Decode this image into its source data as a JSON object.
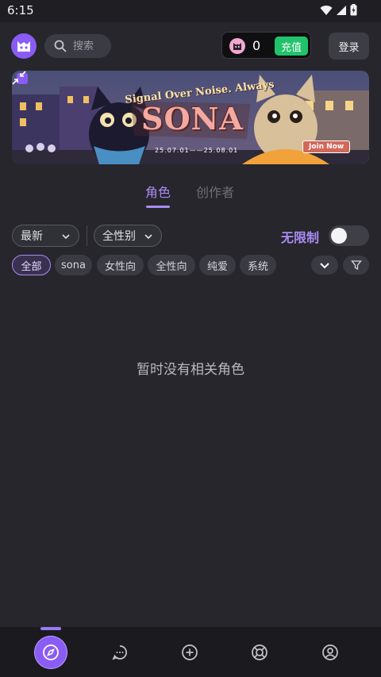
{
  "status_bar": {
    "time": "6:15",
    "icons": [
      "wifi-icon",
      "signal-icon",
      "battery-icon"
    ]
  },
  "header": {
    "logo": "app-logo",
    "search": {
      "placeholder": "搜索"
    },
    "coins": {
      "count": "0",
      "recharge_label": "充值"
    },
    "login_label": "登录"
  },
  "banner": {
    "slogan": "Signal Over Noise. Always",
    "title": "SONA",
    "date_range": "25.07.01——25.08.01",
    "cta_label": "Join Now"
  },
  "tabs": [
    {
      "label": "角色",
      "active": true
    },
    {
      "label": "创作者",
      "active": false
    }
  ],
  "filters": {
    "sort": {
      "selected": "最新"
    },
    "gender": {
      "selected": "全性别"
    },
    "unlimited_label": "无限制",
    "unlimited_on": false
  },
  "categories": [
    {
      "label": "全部",
      "active": true
    },
    {
      "label": "sona",
      "active": false
    },
    {
      "label": "女性向",
      "active": false
    },
    {
      "label": "全性向",
      "active": false
    },
    {
      "label": "纯爱",
      "active": false
    },
    {
      "label": "系统",
      "active": false
    }
  ],
  "empty_state": {
    "message": "暂时没有相关角色"
  },
  "bottom_nav": {
    "items": [
      {
        "icon": "compass-icon",
        "active": true
      },
      {
        "icon": "chat-icon",
        "active": false
      },
      {
        "icon": "plus-circle-icon",
        "active": false
      },
      {
        "icon": "lifebuoy-icon",
        "active": false
      },
      {
        "icon": "profile-icon",
        "active": false
      }
    ]
  },
  "colors": {
    "background": "#26262c",
    "accent": "#a98cf5",
    "brand": "#8a5cf5",
    "recharge": "#22c26a"
  }
}
